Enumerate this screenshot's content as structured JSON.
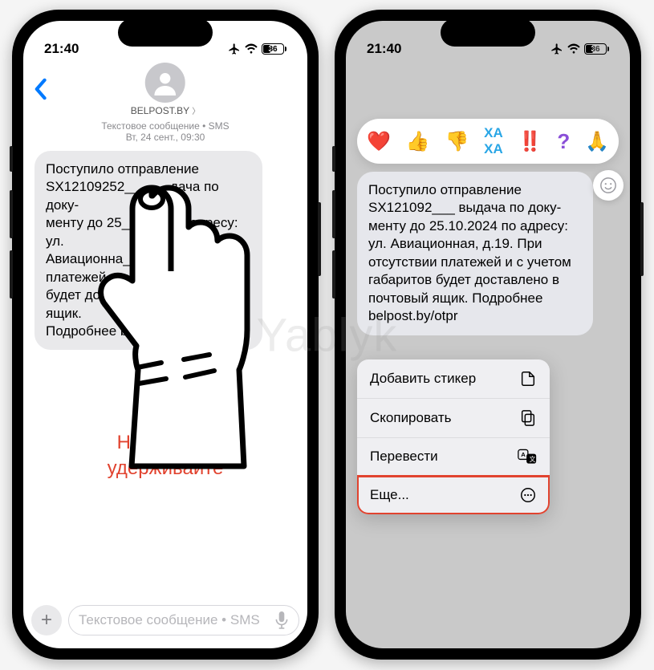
{
  "watermark": "Yablyk",
  "status": {
    "time": "21:40",
    "battery_pct": "36"
  },
  "left": {
    "contact_name": "BELPOST.BY",
    "meta": "Текстовое сообщение • SMS",
    "meta_date": "Вт, 24 сент., 09:30",
    "msg_partial_l1": "Поступило отправление",
    "msg_partial_l2": "SX12109252______дача по доку-",
    "msg_partial_l3": "менту до 25______ по адресу: ул.",
    "msg_partial_l4": "Авиационна____При отсутствии",
    "msg_partial_l5": "платежей и ______габаритов",
    "msg_partial_l6": "будет достав______чтовый ящик.",
    "msg_partial_l7": "Подробнее be______otpr",
    "instruction_l1": "Нажмите и",
    "instruction_l2": "удерживайте"
  },
  "right": {
    "msg": "Поступило отправление SX121092___ выдача по доку­менту до 25.10.2024 по адресу: ул. Авиационная, д.19. При отсутствии платежей и с учетом габаритов будет доставлено в почтовый ящик. Подробнее belpost.by/otpr",
    "reactions": {
      "heart": "❤️",
      "up": "👍",
      "down": "👎",
      "haha": "😆",
      "bang": "‼️",
      "q": "?",
      "pray": "🙏"
    },
    "menu": {
      "sticker": "Добавить стикер",
      "copy": "Скопировать",
      "translate": "Перевести",
      "more": "Еще..."
    }
  },
  "compose": {
    "placeholder": "Текстовое сообщение • SMS",
    "plus": "+"
  }
}
